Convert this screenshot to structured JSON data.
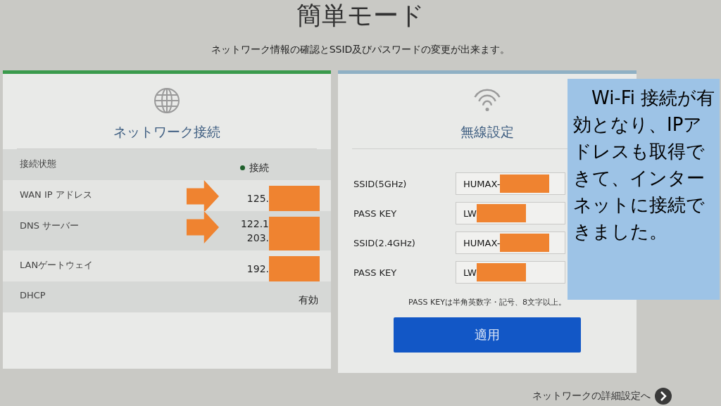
{
  "page": {
    "title": "簡単モード",
    "subtitle": "ネットワーク情報の確認とSSID及びパスワードの変更が出来ます。"
  },
  "network_card": {
    "title": "ネットワーク接続",
    "rows": [
      {
        "label": "接続状態",
        "values": [
          "接続"
        ],
        "kind": "status",
        "color": "#1d5e2a",
        "redacted": false,
        "arrow": false
      },
      {
        "label": "WAN IP アドレス",
        "values": [
          "125."
        ],
        "kind": "text",
        "redacted": true,
        "arrow": true
      },
      {
        "label": "DNS サーバー",
        "values": [
          "122.1",
          "203."
        ],
        "kind": "text",
        "redacted": true,
        "arrow": true
      },
      {
        "label": "LANゲートウェイ",
        "values": [
          "192."
        ],
        "kind": "text",
        "redacted": true,
        "arrow": false
      },
      {
        "label": "DHCP",
        "values": [
          "有効"
        ],
        "kind": "text",
        "redacted": false,
        "arrow": false
      }
    ]
  },
  "wireless_card": {
    "title": "無線設定",
    "fields": [
      {
        "label": "SSID(5GHz)",
        "value": "HUMAX-",
        "redacted": true
      },
      {
        "label": "PASS KEY",
        "value": "LW",
        "redacted": true
      },
      {
        "label": "SSID(2.4GHz)",
        "value": "HUMAX-",
        "redacted": true
      },
      {
        "label": "PASS KEY",
        "value": "LW",
        "redacted": true
      }
    ],
    "note": "PASS KEYは半角英数字・記号、8文字以上。",
    "button": "適用"
  },
  "footer_link": "ネットワークの詳細設定へ",
  "callout": "　Wi-Fi 接続が有効となり、IPアドレスも取得できて、インターネットに接続できました。"
}
